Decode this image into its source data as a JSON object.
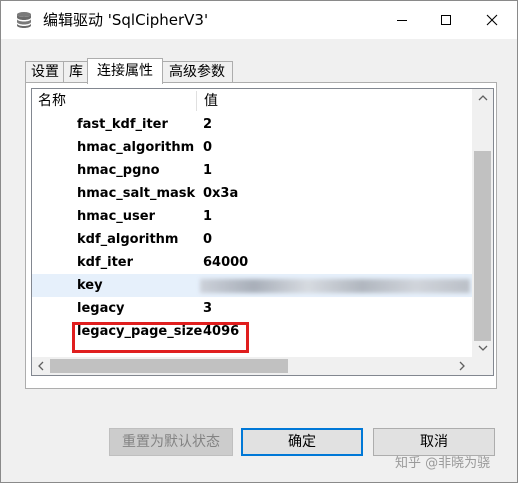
{
  "window": {
    "title": "编辑驱动 'SqlCipherV3'",
    "icon": "database-icon"
  },
  "tabs": [
    {
      "label": "设置"
    },
    {
      "label": "库"
    },
    {
      "label": "连接属性",
      "active": true
    },
    {
      "label": "高级参数"
    }
  ],
  "table": {
    "headers": {
      "name": "名称",
      "value": "值"
    },
    "rows": [
      {
        "name": "fast_kdf_iter",
        "value": "2"
      },
      {
        "name": "hmac_algorithm",
        "value": "0"
      },
      {
        "name": "hmac_pgno",
        "value": "1"
      },
      {
        "name": "hmac_salt_mask",
        "value": "0x3a"
      },
      {
        "name": "hmac_user",
        "value": "1"
      },
      {
        "name": "kdf_algorithm",
        "value": "0"
      },
      {
        "name": "kdf_iter",
        "value": "64000"
      },
      {
        "name": "key",
        "value": ""
      },
      {
        "name": "legacy",
        "value": "3"
      },
      {
        "name": "legacy_page_size",
        "value": "4096"
      }
    ],
    "selected_row": "key",
    "highlight_color": "#e01e1e"
  },
  "buttons": {
    "reset": "重置为默认状态",
    "ok": "确定",
    "cancel": "取消"
  },
  "watermark": "知乎 @非晓为骁"
}
